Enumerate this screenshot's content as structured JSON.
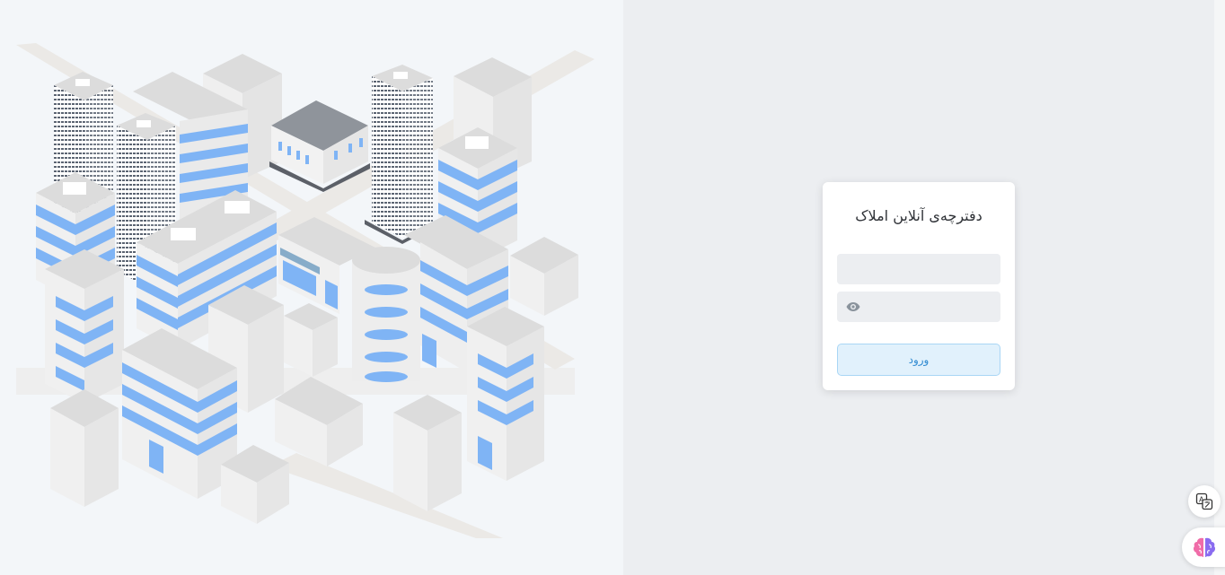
{
  "login": {
    "title": "دفترچه‌ی آنلاین املاک",
    "username_placeholder": "",
    "username_value": "",
    "password_placeholder": "",
    "password_value": "",
    "submit_label": "ورود"
  },
  "icons": {
    "password_toggle": "eye-icon",
    "translate": "translate-icon",
    "assistant": "brain-icon"
  },
  "colors": {
    "accent": "#2f8ad1",
    "button_bg": "#e1f1fc",
    "building_blue": "#7fb4f5"
  }
}
